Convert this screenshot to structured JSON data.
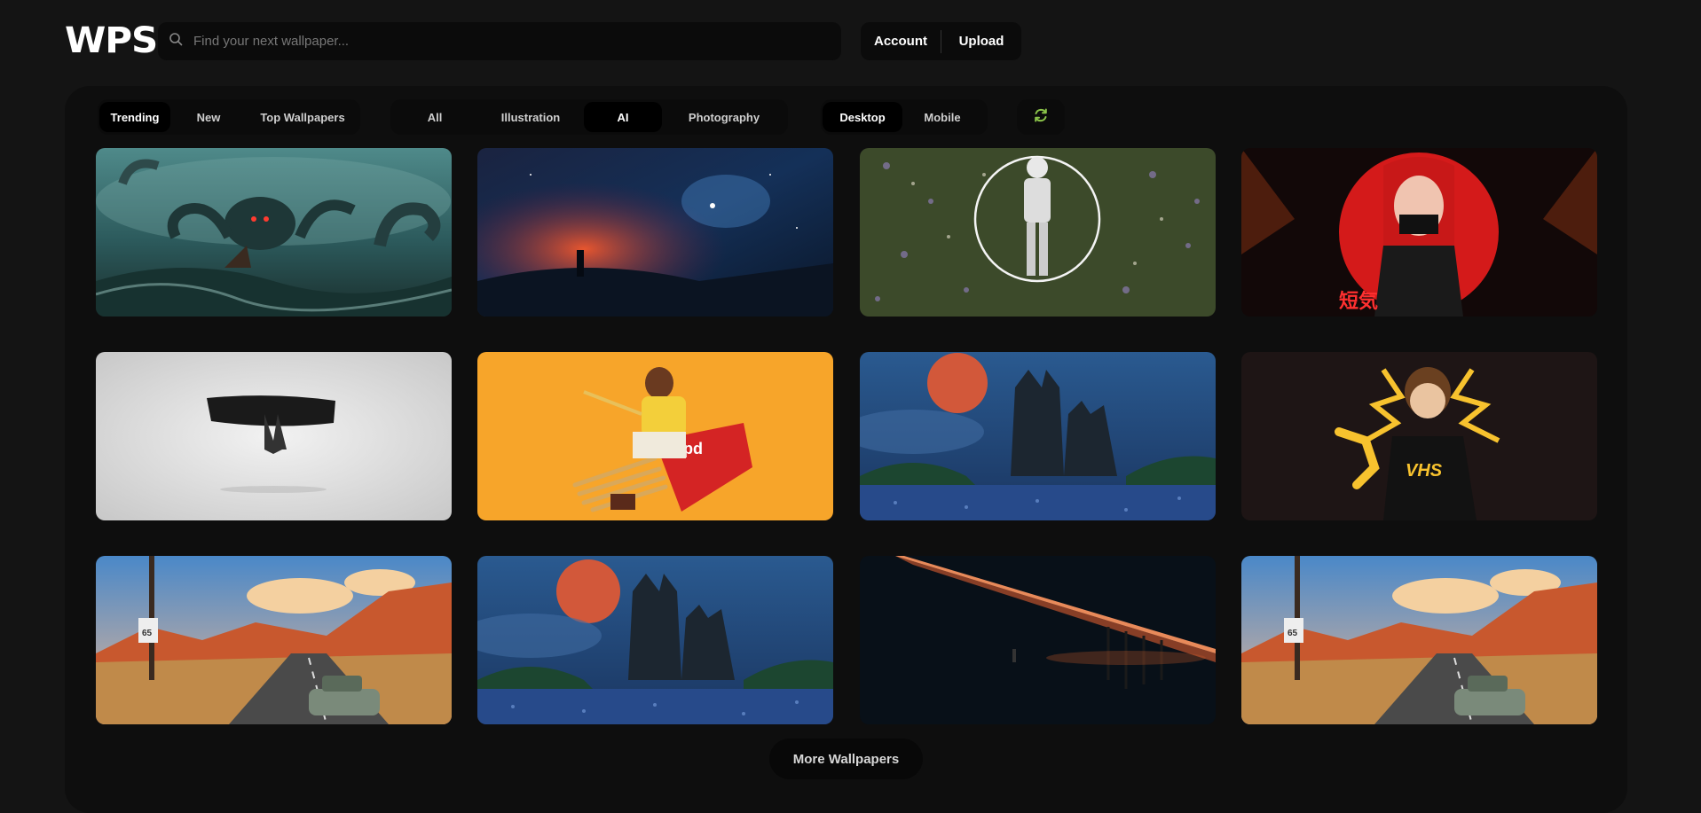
{
  "header": {
    "logo": "WPS",
    "search_placeholder": "Find your next wallpaper...",
    "account_label": "Account",
    "upload_label": "Upload"
  },
  "filters": {
    "sort": [
      {
        "label": "Trending",
        "active": true
      },
      {
        "label": "New",
        "active": false
      },
      {
        "label": "Top Wallpapers",
        "active": false
      }
    ],
    "category": [
      {
        "label": "All",
        "active": false
      },
      {
        "label": "Illustration",
        "active": false
      },
      {
        "label": "AI",
        "active": true
      },
      {
        "label": "Photography",
        "active": false
      }
    ],
    "device": [
      {
        "label": "Desktop",
        "active": true
      },
      {
        "label": "Mobile",
        "active": false
      }
    ],
    "refresh_icon_color": "#8bc34a"
  },
  "wallpapers": [
    {
      "name": "kraken-sea-storm"
    },
    {
      "name": "cosmic-nebula-silhouette"
    },
    {
      "name": "astronaut-in-flowers"
    },
    {
      "name": "red-demon-anime-girl"
    },
    {
      "name": "ink-brush-samurai"
    },
    {
      "name": "girl-on-pocky-box"
    },
    {
      "name": "blood-moon-cathedral"
    },
    {
      "name": "vhs-lightning-girl"
    },
    {
      "name": "desert-route-65-car"
    },
    {
      "name": "blood-moon-cathedral-2"
    },
    {
      "name": "dark-bridge-sunset"
    },
    {
      "name": "desert-route-65-car-2"
    }
  ],
  "more_label": "More Wallpapers",
  "colors": {
    "background": "#141414",
    "panel": "#0e0e0e",
    "accent": "#8bc34a"
  }
}
